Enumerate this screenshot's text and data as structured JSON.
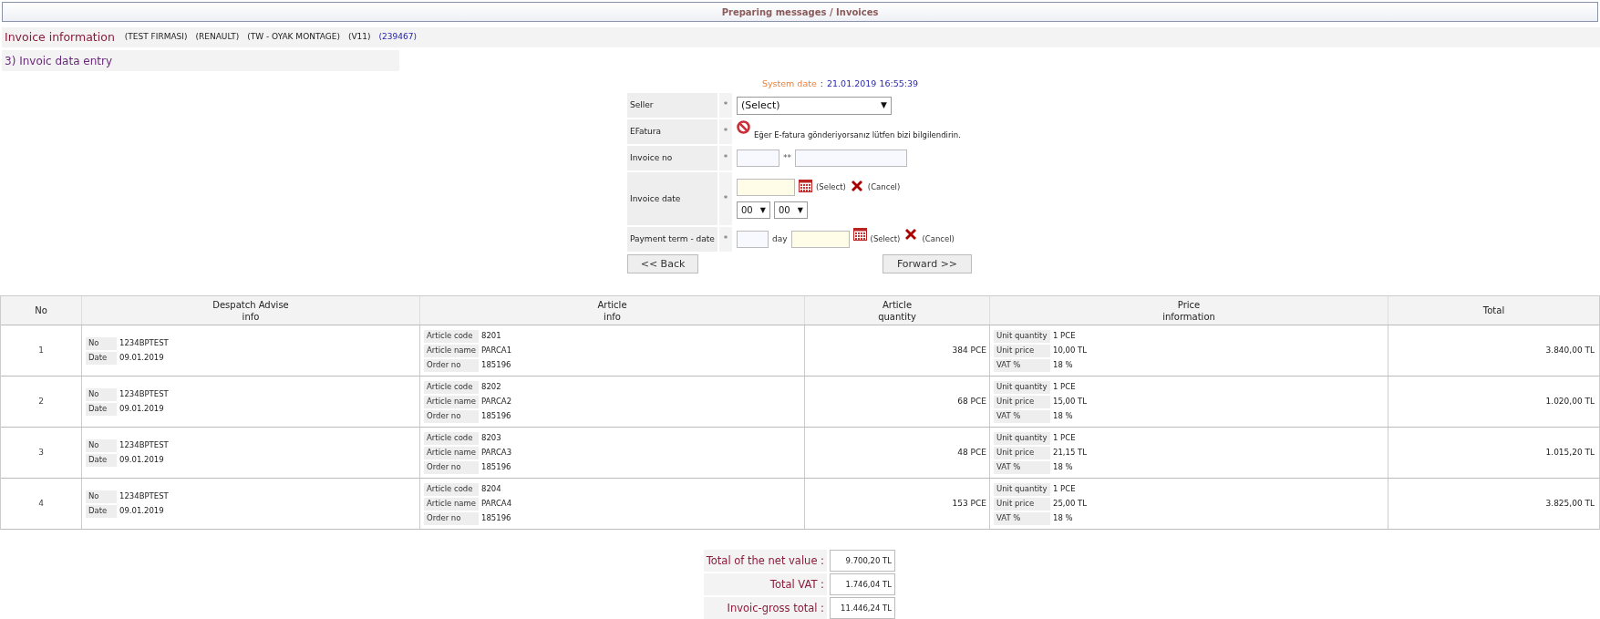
{
  "title_bar": "Preparing messages / Invoices",
  "invoice_info": {
    "label": "Invoice information",
    "tags": [
      "(TEST FIRMASI)",
      "(RENAULT)",
      "(TW - OYAK MONTAGE)",
      "(V11)"
    ],
    "link": "(239467)"
  },
  "section": "3) Invoic data entry",
  "system_date": {
    "label": "System date",
    "sep": ":",
    "value": "21.01.2019 16:55:39"
  },
  "form": {
    "rows": [
      {
        "kind": "select",
        "label": "Seller",
        "req": "*",
        "value": "(Select)",
        "caret": "▼"
      },
      {
        "kind": "note",
        "label": "EFatura",
        "req": "*",
        "text": "Eğer E-fatura gönderiyorsanız lütfen bizi bilgilendirin."
      },
      {
        "kind": "number",
        "label": "Invoice no",
        "req": "*",
        "sep": "**"
      },
      {
        "kind": "date",
        "label": "Invoice date",
        "req": "*",
        "select": "(Select)",
        "cancel": "(Cancel)",
        "hours": [
          {
            "value": "00",
            "caret": "▼"
          },
          {
            "value": "00",
            "caret": "▼"
          }
        ]
      },
      {
        "kind": "term",
        "label": "Payment term - date",
        "req": "*",
        "unit": "day",
        "select": "(Select)",
        "cancel": "(Cancel)"
      }
    ],
    "back": "<< Back",
    "forward": "Forward >>"
  },
  "table": {
    "columns": [
      [
        "No"
      ],
      [
        "Despatch Advise",
        "info"
      ],
      [
        "Article",
        "info"
      ],
      [
        "Article",
        "quantity"
      ],
      [
        "Price",
        "information"
      ],
      [
        "Total"
      ]
    ],
    "rows": [
      {
        "no": "1",
        "despatch": [
          [
            "No",
            "1234BPTEST"
          ],
          [
            "Date",
            "09.01.2019"
          ]
        ],
        "article": [
          [
            "Article code",
            "8201"
          ],
          [
            "Article name",
            "PARCA1"
          ],
          [
            "Order no",
            "185196"
          ]
        ],
        "quantity": "384 PCE",
        "price": [
          [
            "Unit quantity",
            "1 PCE"
          ],
          [
            "Unit price",
            "10,00 TL"
          ],
          [
            "VAT %",
            "18 %"
          ]
        ],
        "total": "3.840,00 TL"
      },
      {
        "no": "2",
        "despatch": [
          [
            "No",
            "1234BPTEST"
          ],
          [
            "Date",
            "09.01.2019"
          ]
        ],
        "article": [
          [
            "Article code",
            "8202"
          ],
          [
            "Article name",
            "PARCA2"
          ],
          [
            "Order no",
            "185196"
          ]
        ],
        "quantity": "68 PCE",
        "price": [
          [
            "Unit quantity",
            "1 PCE"
          ],
          [
            "Unit price",
            "15,00 TL"
          ],
          [
            "VAT %",
            "18 %"
          ]
        ],
        "total": "1.020,00 TL"
      },
      {
        "no": "3",
        "despatch": [
          [
            "No",
            "1234BPTEST"
          ],
          [
            "Date",
            "09.01.2019"
          ]
        ],
        "article": [
          [
            "Article code",
            "8203"
          ],
          [
            "Article name",
            "PARCA3"
          ],
          [
            "Order no",
            "185196"
          ]
        ],
        "quantity": "48 PCE",
        "price": [
          [
            "Unit quantity",
            "1 PCE"
          ],
          [
            "Unit price",
            "21,15 TL"
          ],
          [
            "VAT %",
            "18 %"
          ]
        ],
        "total": "1.015,20 TL"
      },
      {
        "no": "4",
        "despatch": [
          [
            "No",
            "1234BPTEST"
          ],
          [
            "Date",
            "09.01.2019"
          ]
        ],
        "article": [
          [
            "Article code",
            "8204"
          ],
          [
            "Article name",
            "PARCA4"
          ],
          [
            "Order no",
            "185196"
          ]
        ],
        "quantity": "153 PCE",
        "price": [
          [
            "Unit quantity",
            "1 PCE"
          ],
          [
            "Unit price",
            "25,00 TL"
          ],
          [
            "VAT %",
            "18 %"
          ]
        ],
        "total": "3.825,00 TL"
      }
    ]
  },
  "totals": [
    {
      "label": "Total of the net value :",
      "value": "9.700,20 TL"
    },
    {
      "label": "Total VAT :",
      "value": "1.746,04 TL"
    },
    {
      "label": "Invoic-gross total :",
      "value": "11.446,24 TL"
    }
  ]
}
